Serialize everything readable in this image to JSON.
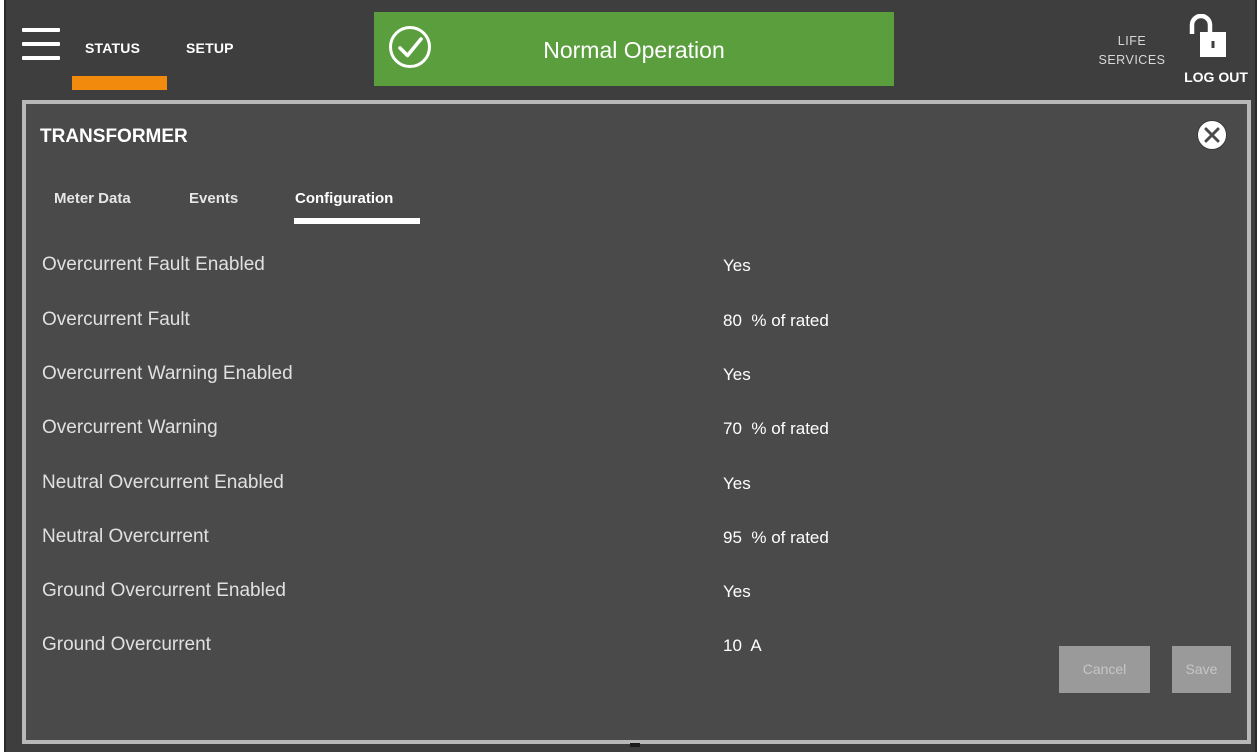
{
  "topbar": {
    "nav_tabs": [
      {
        "label": "STATUS",
        "active": true
      },
      {
        "label": "SETUP",
        "active": false
      }
    ],
    "active_indicator_color": "#f28a0e",
    "status_banner": {
      "text": "Normal Operation",
      "icon": "check-circle-icon",
      "color": "#5a9e3e"
    },
    "life_services": {
      "line1": "LIFE",
      "line2": "SERVICES"
    },
    "logout": {
      "label": "LOG OUT",
      "icon": "unlocked-padlock-icon"
    }
  },
  "panel": {
    "title": "TRANSFORMER",
    "close_icon": "close-circle-icon",
    "tabs": [
      {
        "label": "Meter Data",
        "active": false
      },
      {
        "label": "Events",
        "active": false
      },
      {
        "label": "Configuration",
        "active": true
      }
    ],
    "rows": [
      {
        "label": "Overcurrent Fault Enabled",
        "value": "Yes"
      },
      {
        "label": "Overcurrent Fault",
        "value": "80  % of rated"
      },
      {
        "label": "Overcurrent Warning Enabled",
        "value": "Yes"
      },
      {
        "label": "Overcurrent Warning",
        "value": "70  % of rated"
      },
      {
        "label": "Neutral Overcurrent Enabled",
        "value": "Yes"
      },
      {
        "label": "Neutral Overcurrent",
        "value": "95  % of rated"
      },
      {
        "label": "Ground Overcurrent Enabled",
        "value": "Yes"
      },
      {
        "label": "Ground Overcurrent",
        "value": "10  A"
      }
    ],
    "buttons": {
      "cancel_label": "Cancel",
      "save_label": "Save"
    }
  }
}
